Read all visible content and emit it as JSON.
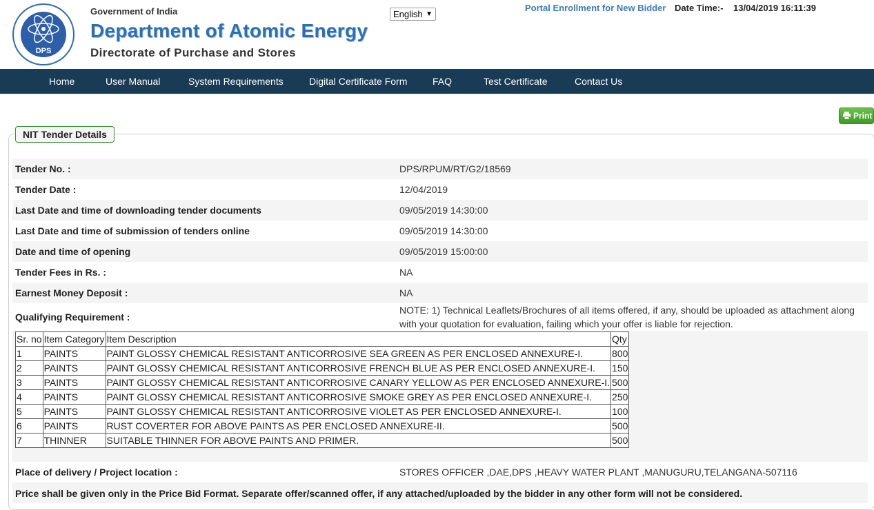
{
  "header": {
    "logo_text": "DPS",
    "gov": "Government of India",
    "department": "Department of Atomic Energy",
    "directorate": "Directorate of Purchase and Stores",
    "language": "English",
    "portal_link": "Portal Enrollment for New Bidder",
    "datetime_label": "Date Time:-",
    "datetime_value": "13/04/2019 16:11:39"
  },
  "nav": [
    "Home",
    "User Manual",
    "System Requirements",
    "Digital Certificate Form",
    "FAQ",
    "Test Certificate",
    "Contact Us"
  ],
  "print_label": "Print",
  "panel_title": "NIT Tender Details",
  "details": [
    {
      "label": "Tender No. :",
      "value": "DPS/RPUM/RT/G2/18569"
    },
    {
      "label": "Tender Date :",
      "value": "12/04/2019"
    },
    {
      "label": "Last Date and time of downloading tender documents",
      "value": "09/05/2019 14:30:00"
    },
    {
      "label": "Last Date and time of submission of tenders online",
      "value": "09/05/2019 14:30:00"
    },
    {
      "label": "Date and time of opening",
      "value": "09/05/2019 15:00:00"
    },
    {
      "label": "Tender Fees in Rs. :",
      "value": "NA"
    },
    {
      "label": "Earnest Money Deposit :",
      "value": "NA"
    }
  ],
  "qualifying": {
    "label": "Qualifying Requirement :",
    "note": "NOTE: 1) Technical Leaflets/Brochures of all items offered, if any, should be uploaded as attachment along with your quotation for evaluation, failing which your offer is liable for rejection."
  },
  "items_table": {
    "headers": [
      "Sr. no",
      "Item Category",
      "Item Description",
      "Qty"
    ],
    "rows": [
      [
        "1",
        "PAINTS",
        "PAINT GLOSSY CHEMICAL RESISTANT ANTICORROSIVE SEA GREEN AS PER ENCLOSED ANNEXURE-I.",
        "800"
      ],
      [
        "2",
        "PAINTS",
        "PAINT GLOSSY CHEMICAL RESISTANT ANTICORROSIVE FRENCH BLUE AS PER ENCLOSED ANNEXURE-I.",
        "150"
      ],
      [
        "3",
        "PAINTS",
        "PAINT GLOSSY CHEMICAL RESISTANT ANTICORROSIVE CANARY YELLOW AS PER ENCLOSED ANNEXURE-I.",
        "500"
      ],
      [
        "4",
        "PAINTS",
        "PAINT GLOSSY CHEMICAL RESISTANT ANTICORROSIVE SMOKE GREY AS PER ENCLOSED ANNEXURE-I.",
        "250"
      ],
      [
        "5",
        "PAINTS",
        "PAINT GLOSSY CHEMICAL RESISTANT ANTICORROSIVE VIOLET AS PER ENCLOSED ANNEXURE-I.",
        "100"
      ],
      [
        "6",
        "PAINTS",
        "RUST COVERTER FOR ABOVE PAINTS AS PER ENCLOSED ANNEXURE-II.",
        "500"
      ],
      [
        "7",
        "THINNER",
        "SUITABLE THINNER FOR ABOVE PAINTS AND PRIMER.",
        "500"
      ]
    ]
  },
  "delivery": {
    "label": "Place of delivery / Project location :",
    "value": "STORES OFFICER ,DAE,DPS ,HEAVY WATER PLANT ,MANUGURU,TELANGANA-507116"
  },
  "price_note": "Price shall be given only in the Price Bid Format. Separate offer/scanned offer, if any attached/uploaded by the bidder in any other form will not be considered.",
  "colors": {
    "nav_bg": "#193b55",
    "dept_blue": "#2d6fb6",
    "print_green": "#4fae33"
  }
}
